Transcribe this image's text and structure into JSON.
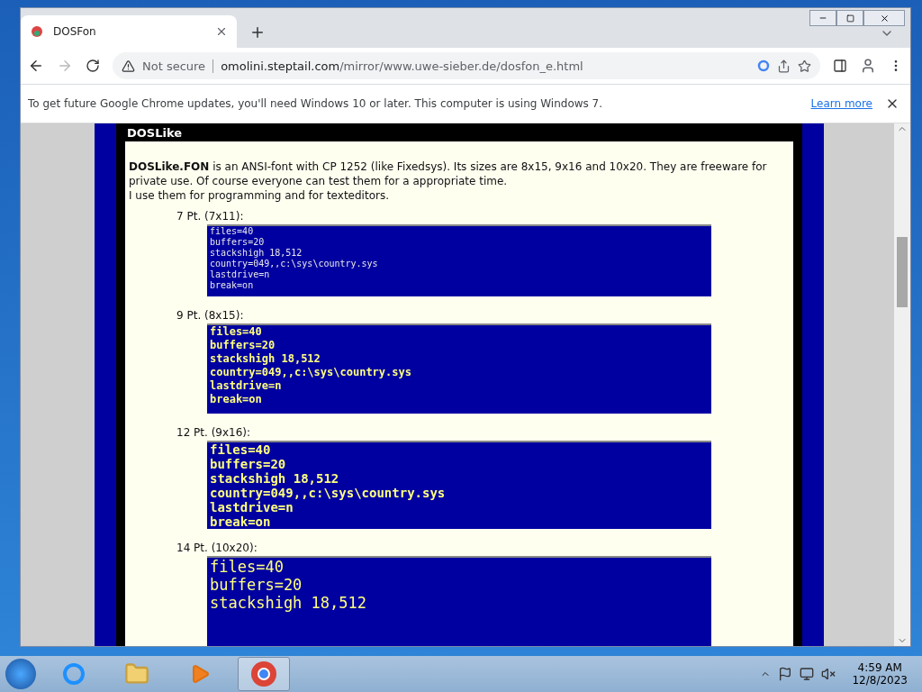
{
  "tab": {
    "title": "DOSFon"
  },
  "address": {
    "security": "Not secure",
    "host": "omolini.steptail.com",
    "path": "/mirror/www.uwe-sieber.de/dosfon_e.html"
  },
  "infobar": {
    "message": "To get future Google Chrome updates, you'll need Windows 10 or later. This computer is using Windows 7.",
    "link": "Learn more"
  },
  "page": {
    "heading": "DOSLike",
    "intro": "**DOSLike.FON** is an ANSI-font with CP 1252 (like Fixedsys). Its sizes are 8x15, 9x16 and 10x20. They are freeware for private use. Of course everyone can test them for a appropriate time.",
    "note": "I use them for programming and for texteditors.",
    "samples": [
      {
        "kind": "small",
        "label": "7 Pt. (7x11):",
        "lines": [
          "files=40",
          "buffers=20",
          "stackshigh 18,512",
          "country=049,,c:\\sys\\country.sys",
          "lastdrive=n",
          "break=on"
        ]
      },
      {
        "kind": "medium",
        "label": "9 Pt. (8x15):",
        "lines": [
          "files=40",
          "buffers=20",
          "stackshigh 18,512",
          "country=049,,c:\\sys\\country.sys",
          "lastdrive=n",
          "break=on"
        ]
      },
      {
        "kind": "large",
        "label": "12 Pt. (9x16):",
        "lines": [
          "files=40",
          "buffers=20",
          "stackshigh 18,512",
          "country=049,,c:\\sys\\country.sys",
          "lastdrive=n",
          "break=on"
        ]
      },
      {
        "kind": "xlarge",
        "label": "14 Pt. (10x20):",
        "lines": [
          "files=40",
          "buffers=20",
          "stackshigh 18,512"
        ]
      }
    ]
  },
  "taskbar": {
    "time": "4:59 AM",
    "date": "12/8/2023"
  }
}
